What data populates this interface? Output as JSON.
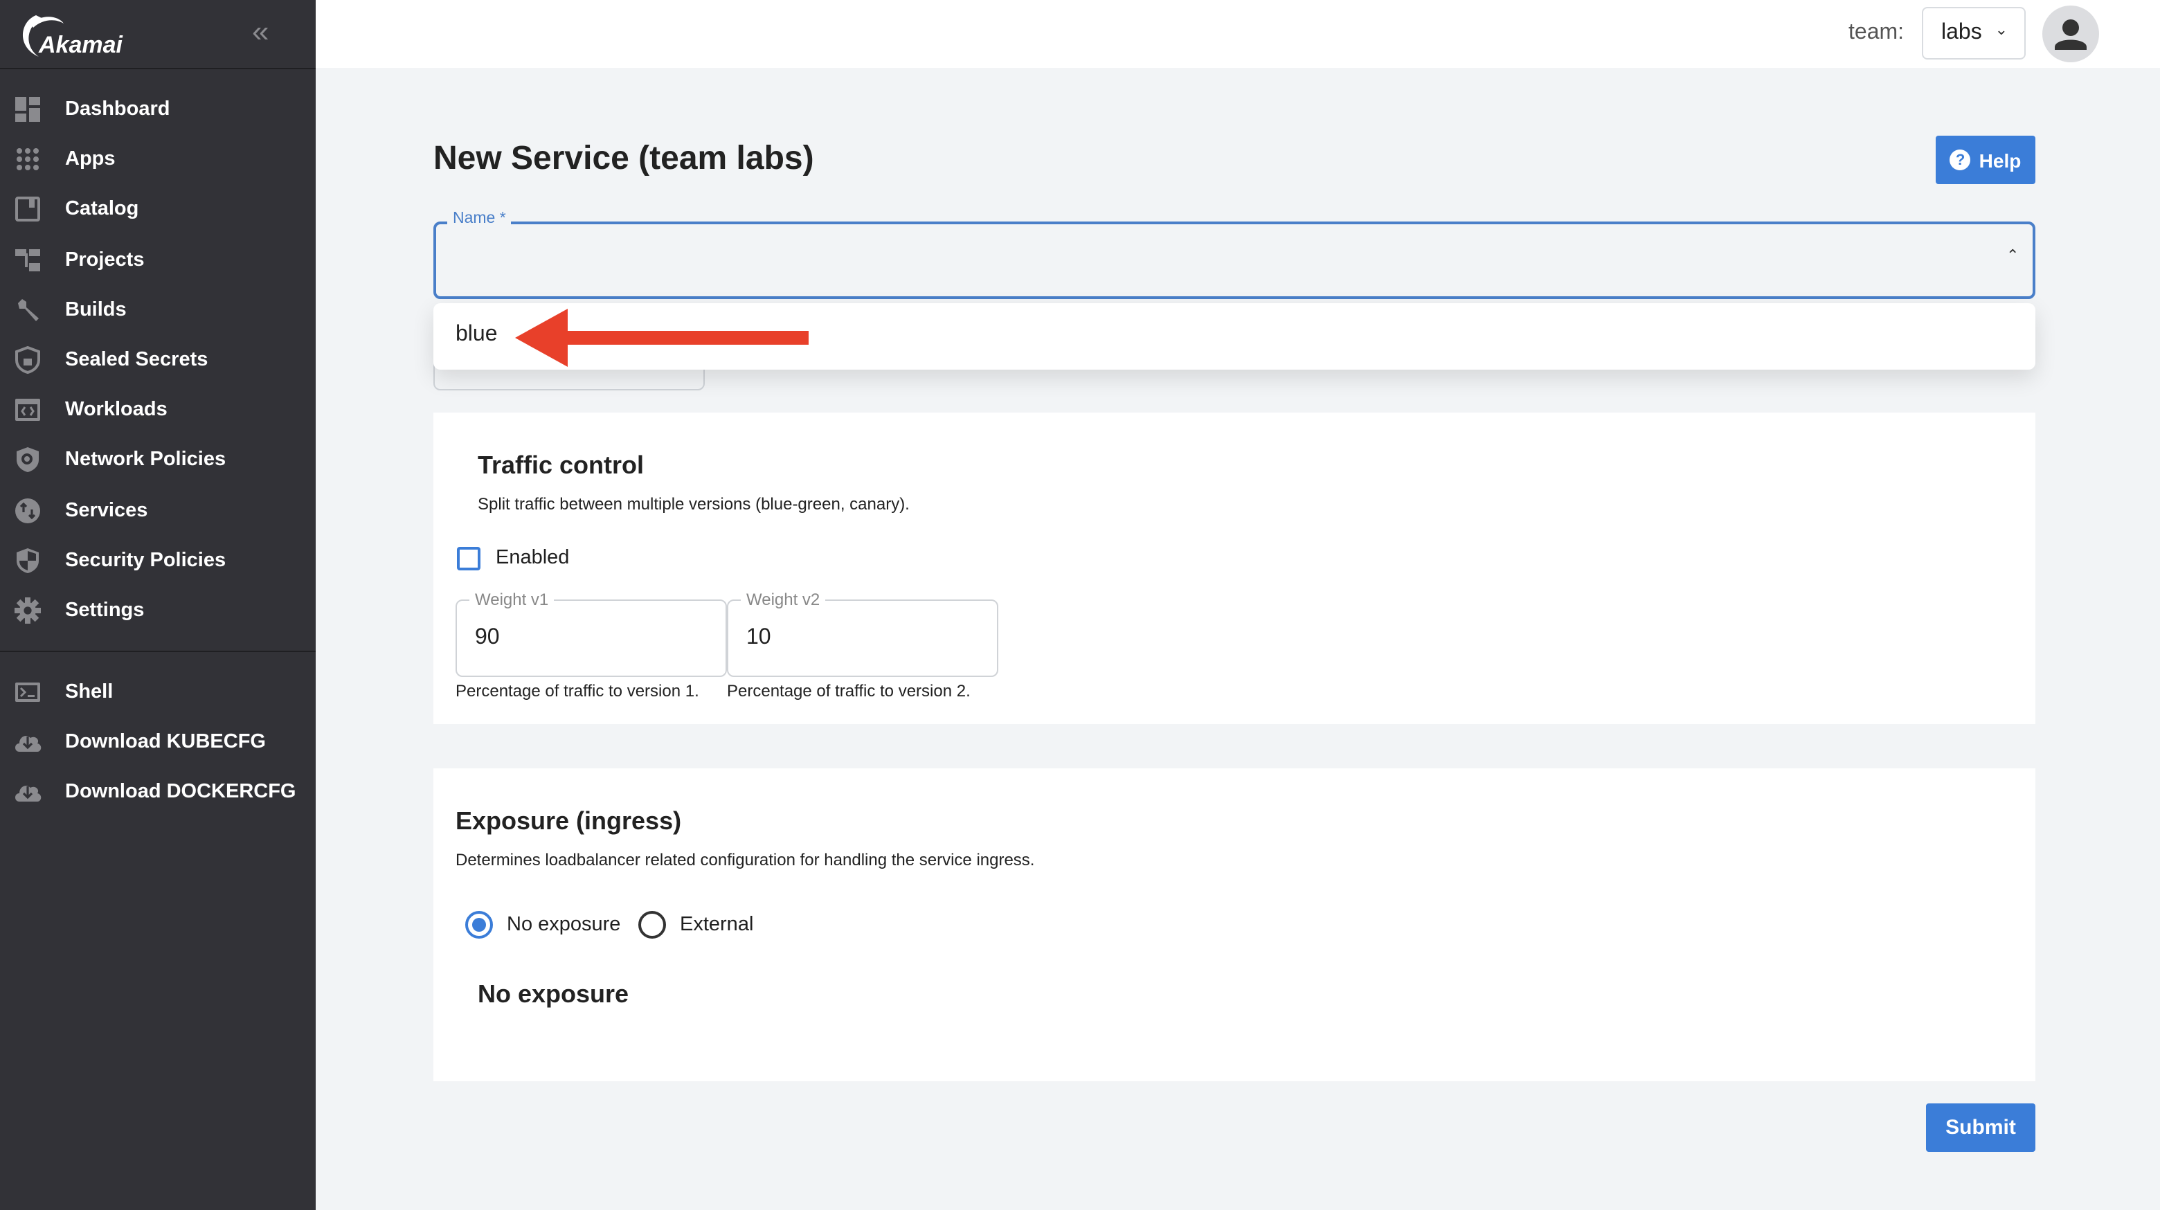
{
  "sidebar": {
    "logo_text": "Akamai",
    "collapse_icon": "double-chevron-left-icon",
    "items": [
      {
        "label": "Dashboard",
        "icon": "dashboard"
      },
      {
        "label": "Apps",
        "icon": "apps"
      },
      {
        "label": "Catalog",
        "icon": "catalog"
      },
      {
        "label": "Projects",
        "icon": "projects"
      },
      {
        "label": "Builds",
        "icon": "wrench"
      },
      {
        "label": "Sealed Secrets",
        "icon": "shield-lock"
      },
      {
        "label": "Workloads",
        "icon": "workloads"
      },
      {
        "label": "Network Policies",
        "icon": "shield-search"
      },
      {
        "label": "Services",
        "icon": "services"
      },
      {
        "label": "Security Policies",
        "icon": "security-shield"
      },
      {
        "label": "Settings",
        "icon": "gear"
      }
    ],
    "bottom_items": [
      {
        "label": "Shell",
        "icon": "terminal"
      },
      {
        "label": "Download KUBECFG",
        "icon": "cloud-download"
      },
      {
        "label": "Download DOCKERCFG",
        "icon": "cloud-download"
      }
    ]
  },
  "header": {
    "team_label": "team:",
    "team_value": "labs"
  },
  "page": {
    "title": "New Service (team labs)",
    "help_label": "Help",
    "name_field": {
      "label": "Name *",
      "value": ""
    },
    "dropdown_options": [
      "blue"
    ],
    "traffic": {
      "title": "Traffic control",
      "description": "Split traffic between multiple versions (blue-green, canary).",
      "enabled_label": "Enabled",
      "enabled": false,
      "weight_v1": {
        "label": "Weight v1",
        "value": "90",
        "helper": "Percentage of traffic to version 1."
      },
      "weight_v2": {
        "label": "Weight v2",
        "value": "10",
        "helper": "Percentage of traffic to version 2."
      }
    },
    "exposure": {
      "title": "Exposure (ingress)",
      "description": "Determines loadbalancer related configuration for handling the service ingress.",
      "options": [
        "No exposure",
        "External"
      ],
      "selected": "No exposure",
      "subheading": "No exposure"
    },
    "submit_label": "Submit"
  },
  "colors": {
    "sidebar": "#323237",
    "accent": "#3b7dd8",
    "annotation_arrow": "#e8402a"
  }
}
